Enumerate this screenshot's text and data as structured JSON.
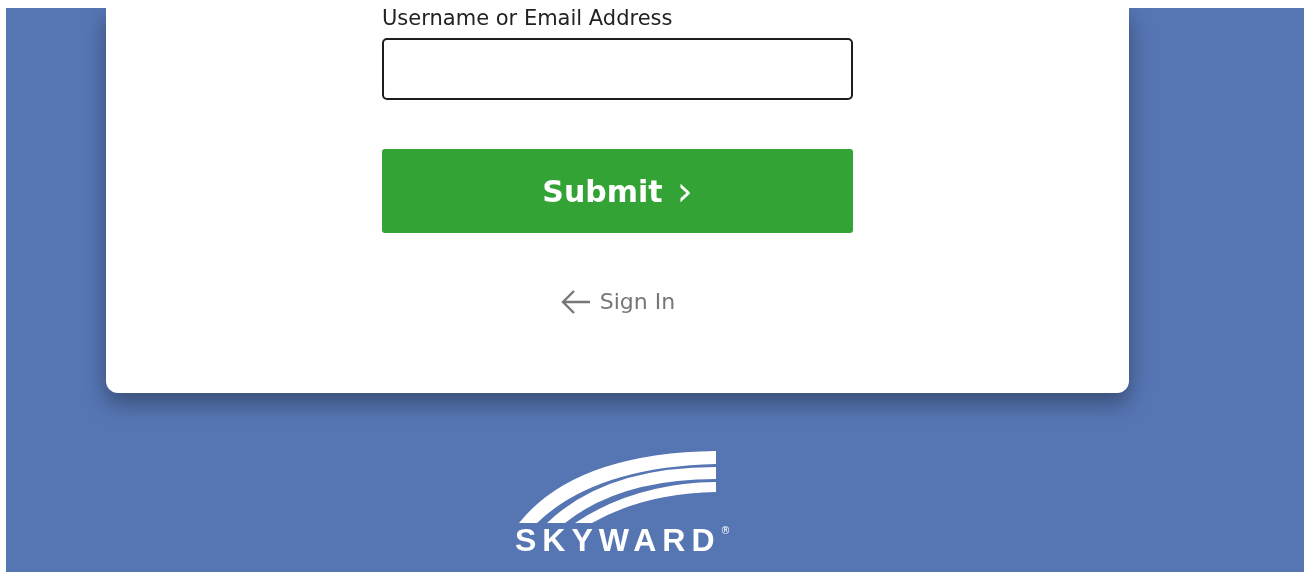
{
  "form": {
    "field_label": "Username or Email Address",
    "submit_label": "Submit",
    "submit_icon": "›",
    "back_link": "Sign In"
  },
  "logo": {
    "text": "SKYWARD",
    "mark": "®"
  }
}
